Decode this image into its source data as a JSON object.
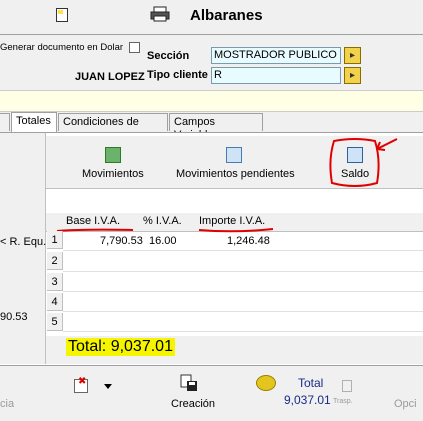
{
  "window": {
    "title": "Albaranes"
  },
  "header": {
    "generar_dolar_label": "Generar documento en Dolar",
    "seccion_label": "Sección",
    "seccion_value": "MOSTRADOR PUBLICO",
    "tipo_cliente_label": "Tipo cliente",
    "tipo_cliente_value": "R",
    "user_name": "JUAN LOPEZ"
  },
  "tabs": [
    {
      "label": "Totales",
      "active": true
    },
    {
      "label": "Condiciones de pago",
      "active": false
    },
    {
      "label": "Campos Variables",
      "active": false
    }
  ],
  "left_panel": {
    "re_equ_label": "< R. Equ.",
    "value": "90.53"
  },
  "actions": {
    "movimientos": "Movimientos",
    "movimientos_pendientes": "Movimientos pendientes",
    "saldo": "Saldo"
  },
  "grid": {
    "headers": [
      "Base I.V.A.",
      "% I.V.A.",
      "Importe I.V.A."
    ],
    "rows": [
      {
        "num": "1",
        "base": "7,790.53",
        "pct": "16.00",
        "importe": "1,246.48"
      },
      {
        "num": "2",
        "base": "",
        "pct": "",
        "importe": ""
      },
      {
        "num": "3",
        "base": "",
        "pct": "",
        "importe": ""
      },
      {
        "num": "4",
        "base": "",
        "pct": "",
        "importe": ""
      },
      {
        "num": "5",
        "base": "",
        "pct": "",
        "importe": ""
      }
    ]
  },
  "total": {
    "text": "Total: 9,037.01"
  },
  "toolbar": {
    "left_label": "cia",
    "creacion_label": "Creación",
    "total_title": "Total",
    "total_value": "9,037.01",
    "trasp_label": "Trasp.",
    "right_label": "Opci"
  },
  "colors": {
    "highlight_yellow": "#f5f500",
    "input_bg": "#e8fbff",
    "annotation_red": "#e00000",
    "total_blue": "#1a2a8a"
  }
}
